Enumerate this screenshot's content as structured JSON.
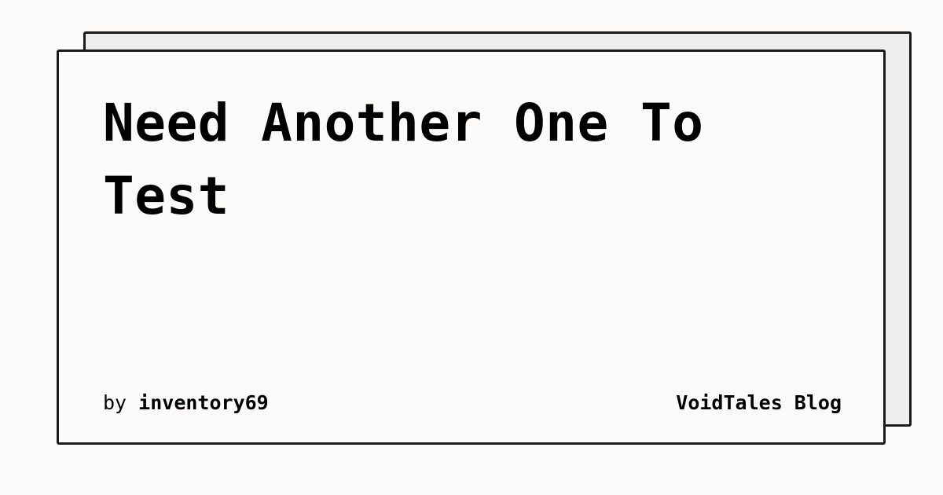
{
  "card": {
    "title": "Need Another One To Test",
    "byline_prefix": "by",
    "author": "inventory69",
    "blog_name": "VoidTales Blog"
  },
  "colors": {
    "background": "#fcfbf9",
    "back_card": "#eeeeee",
    "border": "#1a1a1a",
    "text": "#000000"
  }
}
